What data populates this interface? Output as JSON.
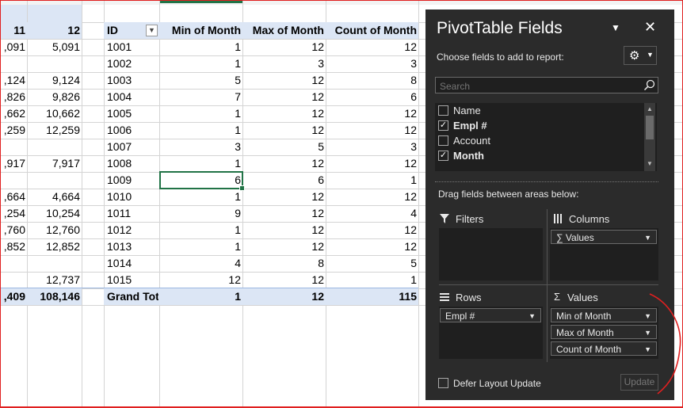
{
  "sheet": {
    "left_headers": [
      "11",
      "12"
    ],
    "left_rows": [
      [
        ",091",
        "5,091"
      ],
      [
        "",
        ""
      ],
      [
        ",124",
        "9,124"
      ],
      [
        ",826",
        "9,826"
      ],
      [
        ",662",
        "10,662"
      ],
      [
        ",259",
        "12,259"
      ],
      [
        "",
        ""
      ],
      [
        ",917",
        "7,917"
      ],
      [
        "",
        ""
      ],
      [
        ",664",
        "4,664"
      ],
      [
        ",254",
        "10,254"
      ],
      [
        ",760",
        "12,760"
      ],
      [
        ",852",
        "12,852"
      ],
      [
        "",
        ""
      ],
      [
        "",
        "12,737"
      ]
    ],
    "left_total": [
      ",409",
      "108,146"
    ],
    "pivot_headers": [
      "ID",
      "Min of Month",
      "Max of Month",
      "Count of Month"
    ],
    "pivot_rows": [
      [
        "1001",
        "1",
        "12",
        "12"
      ],
      [
        "1002",
        "1",
        "3",
        "3"
      ],
      [
        "1003",
        "5",
        "12",
        "8"
      ],
      [
        "1004",
        "7",
        "12",
        "6"
      ],
      [
        "1005",
        "1",
        "12",
        "12"
      ],
      [
        "1006",
        "1",
        "12",
        "12"
      ],
      [
        "1007",
        "3",
        "5",
        "3"
      ],
      [
        "1008",
        "1",
        "12",
        "12"
      ],
      [
        "1009",
        "6",
        "6",
        "1"
      ],
      [
        "1010",
        "1",
        "12",
        "12"
      ],
      [
        "1011",
        "9",
        "12",
        "4"
      ],
      [
        "1012",
        "1",
        "12",
        "12"
      ],
      [
        "1013",
        "1",
        "12",
        "12"
      ],
      [
        "1014",
        "4",
        "8",
        "5"
      ],
      [
        "1015",
        "12",
        "12",
        "1"
      ]
    ],
    "pivot_total": [
      "Grand Tot",
      "1",
      "12",
      "115"
    ]
  },
  "pane": {
    "title": "PivotTable Fields",
    "choose_label": "Choose fields to add to report:",
    "search_placeholder": "Search",
    "fields": [
      {
        "name": "Name",
        "checked": false,
        "bold": false
      },
      {
        "name": "Empl #",
        "checked": true,
        "bold": true
      },
      {
        "name": "Account",
        "checked": false,
        "bold": false
      },
      {
        "name": "Month",
        "checked": true,
        "bold": true
      }
    ],
    "drag_label": "Drag fields between areas below:",
    "filters_label": "Filters",
    "columns_label": "Columns",
    "rows_label": "Rows",
    "values_label": "Values",
    "columns_chip": "Values",
    "rows_chip": "Empl #",
    "values_chips": [
      "Min of Month",
      "Max of Month",
      "Count of Month"
    ],
    "defer_label": "Defer Layout Update",
    "update_label": "Update"
  },
  "colors": {
    "header_band": "#dce6f5",
    "pane_bg": "#2b2b2b",
    "selection": "#217346",
    "annotation": "#e02020"
  }
}
